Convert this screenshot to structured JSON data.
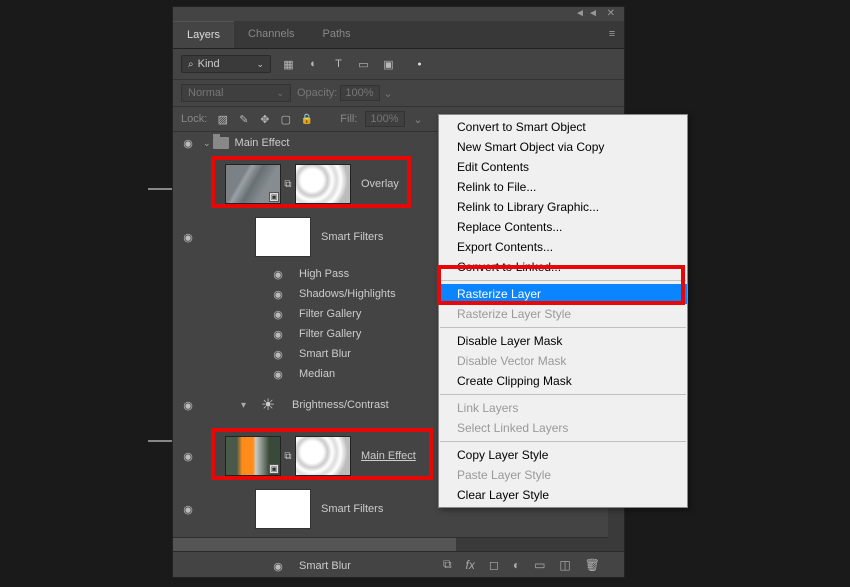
{
  "tabs": {
    "layers": "Layers",
    "channels": "Channels",
    "paths": "Paths"
  },
  "filter": {
    "kind_label": "Kind"
  },
  "blend": {
    "mode": "Normal",
    "opacity_label": "Opacity:",
    "opacity_value": "100%"
  },
  "lock": {
    "label": "Lock:",
    "fill_label": "Fill:",
    "fill_value": "100%"
  },
  "groups": {
    "main_effect": "Main Effect"
  },
  "layers": {
    "overlay": "Overlay",
    "smart_filters": "Smart Filters",
    "brightness_contrast": "Brightness/Contrast",
    "main_effect_layer": "Main Effect"
  },
  "filters": {
    "high_pass": "High Pass",
    "shadows_highlights": "Shadows/Highlights",
    "filter_gallery": "Filter Gallery",
    "smart_blur": "Smart Blur",
    "median": "Median"
  },
  "menu": {
    "convert_smart": "Convert to Smart Object",
    "new_smart_copy": "New Smart Object via Copy",
    "edit_contents": "Edit Contents",
    "relink_file": "Relink to File...",
    "relink_library": "Relink to Library Graphic...",
    "replace_contents": "Replace Contents...",
    "export_contents": "Export Contents...",
    "convert_linked": "Convert to Linked...",
    "rasterize_layer": "Rasterize Layer",
    "rasterize_style": "Rasterize Layer Style",
    "disable_layer_mask": "Disable Layer Mask",
    "disable_vector_mask": "Disable Vector Mask",
    "create_clipping": "Create Clipping Mask",
    "link_layers": "Link Layers",
    "select_linked": "Select Linked Layers",
    "copy_style": "Copy Layer Style",
    "paste_style": "Paste Layer Style",
    "clear_style": "Clear Layer Style"
  },
  "icons": {
    "eye": "◉",
    "search": "⌕",
    "chev_down": "⌄",
    "chev_right": "›",
    "image": "▦",
    "circle_half": "◐",
    "type": "T",
    "shape": "▭",
    "smart": "▣",
    "dot": "●",
    "pixel": "▨",
    "brush": "✎",
    "move": "✥",
    "artboard": "▢",
    "lock": "🔒",
    "link": "⧉",
    "sun": "☀",
    "fx": "fx",
    "mask": "◻",
    "adj": "◐",
    "folder": "▬",
    "new": "⊞",
    "trash": "🗑",
    "bars": "≡"
  }
}
